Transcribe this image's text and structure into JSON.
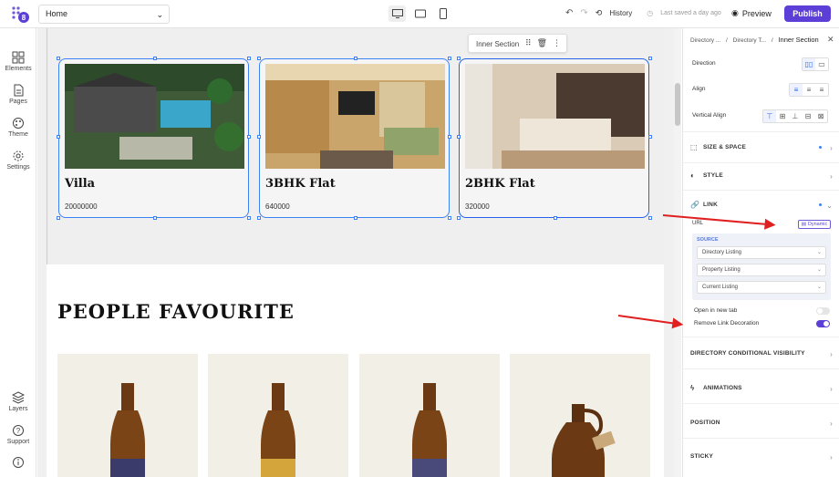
{
  "topbar": {
    "page_selector_value": "Home",
    "history_label": "History",
    "saved_status": "Last saved a day ago",
    "preview_label": "Preview",
    "publish_label": "Publish",
    "accent_color": "#5b3fd6"
  },
  "leftbar": {
    "items": [
      {
        "label": "Elements",
        "icon": "grid-icon"
      },
      {
        "label": "Pages",
        "icon": "document-icon"
      },
      {
        "label": "Theme",
        "icon": "palette-icon"
      },
      {
        "label": "Settings",
        "icon": "gear-icon"
      },
      {
        "label": "Layers",
        "icon": "layers-icon"
      },
      {
        "label": "Support",
        "icon": "help-icon"
      }
    ]
  },
  "canvas": {
    "inner_toolbar_label": "Inner Section",
    "cards": [
      {
        "title": "Villa",
        "price": "20000000"
      },
      {
        "title": "3BHK Flat",
        "price": "640000"
      },
      {
        "title": "2BHK Flat",
        "price": "320000"
      }
    ],
    "heading": "PEOPLE FAVOURITE"
  },
  "rightpanel": {
    "breadcrumbs": [
      "Directory ...",
      "Directory T...",
      "Inner Section"
    ],
    "direction_label": "Direction",
    "align_label": "Align",
    "vertical_align_label": "Vertical Align",
    "size_space_label": "SIZE & SPACE",
    "style_label": "STYLE",
    "link_label": "LINK",
    "url_label": "URL",
    "dynamic_badge": "Dynamic",
    "source_label": "SOURCE",
    "source_fields": [
      "Directory Listing",
      "Property Listing",
      "Current Listing"
    ],
    "open_new_tab_label": "Open in new tab",
    "remove_decoration_label": "Remove Link Decoration",
    "conditional_visibility_label": "DIRECTORY CONDITIONAL VISIBILITY",
    "animations_label": "ANIMATIONS",
    "position_label": "POSITION",
    "sticky_label": "STICKY"
  }
}
